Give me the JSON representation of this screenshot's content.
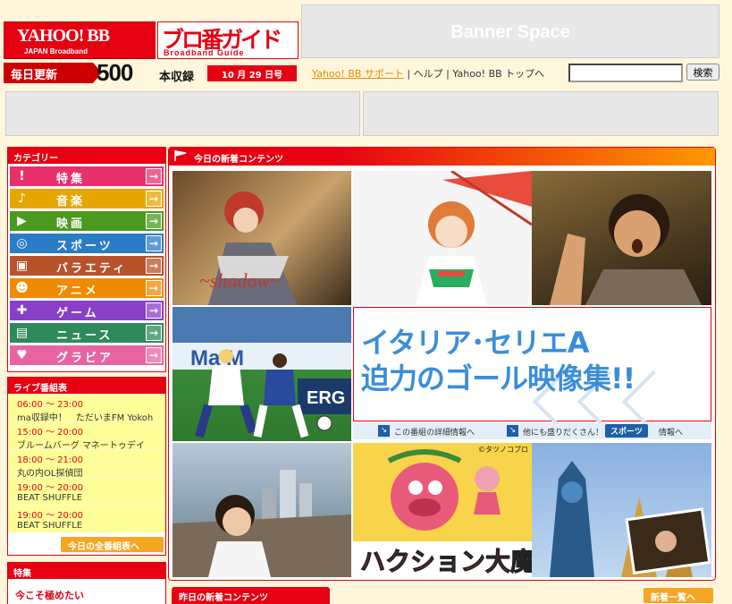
{
  "header": {
    "yahoo_logo": "YAHOO! BB",
    "yahoo_logo_sub": "JAPAN Broadband",
    "guide_logo": "ブロ番ガイド",
    "guide_logo_sub": "Broadband Guide",
    "banner_text": "Banner Space",
    "daily_update": "毎日更新",
    "count_number": "500",
    "count_label": "本収録",
    "issue_date": "10 月 29 日号"
  },
  "toplinks": {
    "support": "Yahoo! BB サポート",
    "sep": " | ",
    "help": "ヘルプ",
    "top": "Yahoo! BB トップへ"
  },
  "search": {
    "value": "",
    "button": "検索"
  },
  "sidebar": {
    "category_head": "カテゴリー",
    "categories": [
      {
        "label": "特集",
        "icon": "exclamation-icon",
        "color": "#e8306d"
      },
      {
        "label": "音楽",
        "icon": "music-icon",
        "color": "#e6a600"
      },
      {
        "label": "映画",
        "icon": "camera-icon",
        "color": "#4a9a1e"
      },
      {
        "label": "スポーツ",
        "icon": "soccer-ball-icon",
        "color": "#2a7dc4"
      },
      {
        "label": "バラエティ",
        "icon": "tv-icon",
        "color": "#b8522a"
      },
      {
        "label": "アニメ",
        "icon": "anime-icon",
        "color": "#f08a00"
      },
      {
        "label": "ゲーム",
        "icon": "gamepad-icon",
        "color": "#8a3fc9"
      },
      {
        "label": "ニュース",
        "icon": "news-icon",
        "color": "#2e8a5a"
      },
      {
        "label": "グラビア",
        "icon": "heart-icon",
        "color": "#e864a0"
      }
    ],
    "live_head": "ライブ番組表",
    "live": [
      {
        "time": "06:00 ～ 23:00",
        "name": "ma収録中！　ただいまFM Yokoh"
      },
      {
        "time": "15:00 ～ 20:00",
        "name": "ブルームバーグ マネートゥデイ"
      },
      {
        "time": "18:00 ～ 21:00",
        "name": "丸の内OL探偵団"
      },
      {
        "time": "19:00 ～ 20:00",
        "name": "BEAT SHUFFLE"
      },
      {
        "time": "19:00 ～ 20:00",
        "name": "BEAT SHUFFLE"
      }
    ],
    "schedule_button": "今日の全番組表へ",
    "feature_head": "特集",
    "feature_text": "今こそ極めたい"
  },
  "main": {
    "head": "今日の新着コンテンツ",
    "headline_line1": "イタリア･セリエA",
    "headline_line2": "迫力のゴール映像集!!",
    "detail_link": "この番組の詳細情報へ",
    "more_link": "他にも盛りだくさん！",
    "sports_tag": "スポーツ",
    "info_link": "情報へ",
    "credit": "©タツノコプロ",
    "anime_title": "ハクション大魔王"
  },
  "bottom": {
    "yesterday_head": "昨日の新着コンテンツ",
    "new_list_button": "新着一覧へ"
  }
}
